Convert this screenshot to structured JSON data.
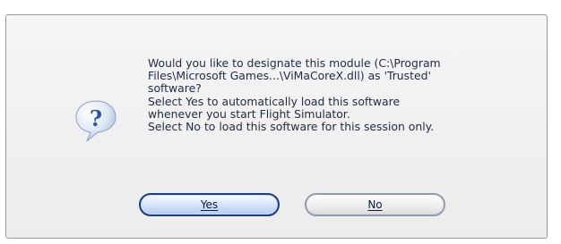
{
  "dialog": {
    "icon": "question-mark-speech-bubble-icon",
    "message_lines": [
      "Would you like to designate this module (C:\\Program",
      "Files\\Microsoft Games...\\ViMaCoreX.dll) as 'Trusted'",
      "software?",
      "Select Yes to automatically load this software",
      "whenever you start Flight Simulator.",
      "Select No to load this software for this session only."
    ],
    "buttons": {
      "yes_label": "Yes",
      "no_label": "No"
    }
  },
  "colors": {
    "accent": "#1d3d84",
    "icon_blue": "#2c55a6",
    "text": "#1f2a44"
  }
}
